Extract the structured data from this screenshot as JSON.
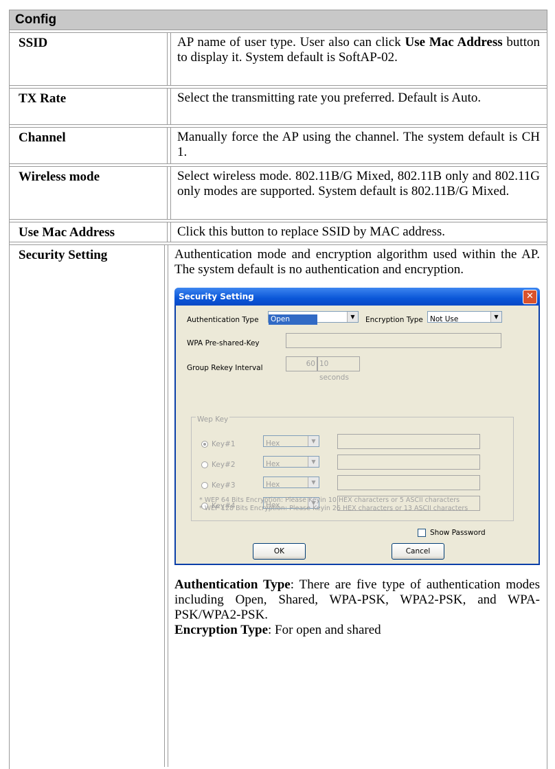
{
  "header": {
    "title": "Config"
  },
  "rows": [
    {
      "term": "SSID",
      "desc_parts": [
        "AP name of user type. User also can click ",
        "Use Mac Address",
        " button to display it. System default is SoftAP-02."
      ]
    },
    {
      "term": "TX Rate",
      "desc": "Select the transmitting rate you preferred. Default is Auto."
    },
    {
      "term": "Channel",
      "desc": "Manually force the AP using the channel. The system default is CH 1."
    },
    {
      "term": "Wireless mode",
      "desc": "Select wireless mode. 802.11B/G Mixed, 802.11B only and 802.11G only modes are supported. System default is 802.11B/G Mixed."
    },
    {
      "term": "Use Mac Address",
      "desc": "Click this button to replace SSID by MAC address."
    },
    {
      "term": "Security Setting",
      "desc": "Authentication mode and encryption algorithm used within the AP. The system default is no authentication and encryption."
    }
  ],
  "dialog": {
    "title": "Security Setting",
    "close_symbol": "✕",
    "auth_label": "Authentication Type",
    "auth_value": "Open",
    "enc_label": "Encryption Type",
    "enc_value": "Not Use",
    "wpa_label": "WPA Pre-shared-Key",
    "rekey_label": "Group Rekey Interval",
    "rekey_value": "60",
    "rekey_unit": "10 seconds",
    "wep_group_label": "Wep Key",
    "keys": [
      {
        "label": "Key#1",
        "format": "Hex",
        "selected": true
      },
      {
        "label": "Key#2",
        "format": "Hex",
        "selected": false
      },
      {
        "label": "Key#3",
        "format": "Hex",
        "selected": false
      },
      {
        "label": "Key#4",
        "format": "Hex",
        "selected": false
      }
    ],
    "note1": "* WEP 64 Bits Encryption:  Please Keyin 10 HEX characters or 5 ASCII characters",
    "note2": "* WEP 128 Bits Encryption:  Please Keyin 26 HEX characters or 13 ASCII characters",
    "show_password_label": "Show Password",
    "ok_label": "OK",
    "cancel_label": "Cancel"
  },
  "auth_para": {
    "bold": "Authentication Type",
    "text": ": There are five type of authentication modes including Open, Shared, WPA-PSK, WPA2-PSK, and WPA-PSK/WPA2-PSK."
  },
  "enc_para": {
    "bold": "Encryption Type",
    "text": ": For open and shared"
  }
}
